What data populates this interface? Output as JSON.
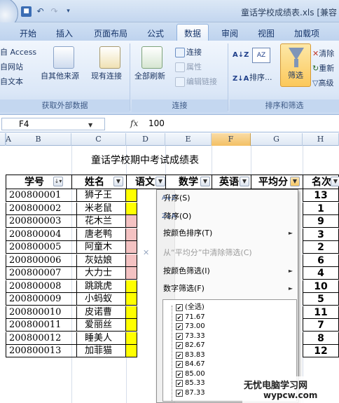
{
  "window": {
    "title": "童话学校成绩表.xls [兼容"
  },
  "tabs": [
    {
      "label": "开始"
    },
    {
      "label": "插入"
    },
    {
      "label": "页面布局"
    },
    {
      "label": "公式"
    },
    {
      "label": "数据"
    },
    {
      "label": "审阅"
    },
    {
      "label": "视图"
    },
    {
      "label": "加载项"
    }
  ],
  "active_tab": "数据",
  "ribbon": {
    "external": {
      "access": "自 Access",
      "web": "自网站",
      "text": "自文本",
      "other_sources": "自其他来源",
      "existing": "现有连接",
      "group_label": "获取外部数据"
    },
    "connections": {
      "refresh_all": "全部刷新",
      "connections": "连接",
      "properties": "属性",
      "edit_links": "编辑链接",
      "group_label": "连接"
    },
    "sort_filter": {
      "sort": "排序...",
      "filter": "筛选",
      "clear": "清除",
      "reapply": "重新",
      "advanced": "高级",
      "group_label": "排序和筛选"
    }
  },
  "formula_bar": {
    "name_box": "F4",
    "fx": "fx",
    "value": "100"
  },
  "columns": [
    "A",
    "B",
    "C",
    "D",
    "E",
    "F",
    "G",
    "H"
  ],
  "selected_column": "F",
  "sheet": {
    "title": "童话学校期中考试成绩表",
    "headers": [
      "学号",
      "姓名",
      "语文",
      "数学",
      "英语",
      "平均分",
      "名次"
    ],
    "rows": [
      {
        "id": "200800001",
        "name": "狮子王",
        "rank": "13",
        "chn_color": "#ffff00"
      },
      {
        "id": "200800002",
        "name": "米老鼠",
        "rank": "1",
        "chn_color": "#ffff00"
      },
      {
        "id": "200800003",
        "name": "花木兰",
        "rank": "9",
        "chn_color": "#f4c2c2"
      },
      {
        "id": "200800004",
        "name": "唐老鸭",
        "rank": "3",
        "chn_color": "#f4c2c2"
      },
      {
        "id": "200800005",
        "name": "阿童木",
        "rank": "2",
        "chn_color": "#f4c2c2"
      },
      {
        "id": "200800006",
        "name": "灰姑娘",
        "rank": "6",
        "chn_color": "#f4c2c2"
      },
      {
        "id": "200800007",
        "name": "大力士",
        "rank": "4",
        "chn_color": "#f4c2c2"
      },
      {
        "id": "200800008",
        "name": "跳跳虎",
        "rank": "10",
        "chn_color": "#ffff00"
      },
      {
        "id": "200800009",
        "name": "小蚂蚁",
        "rank": "5",
        "chn_color": "#ffff00"
      },
      {
        "id": "200800010",
        "name": "皮诺曹",
        "rank": "11",
        "chn_color": "#ffff00"
      },
      {
        "id": "200800011",
        "name": "爱丽丝",
        "rank": "7",
        "chn_color": "#ffff00"
      },
      {
        "id": "200800012",
        "name": "睡美人",
        "rank": "8",
        "chn_color": "#ffff00"
      },
      {
        "id": "200800013",
        "name": "加菲猫",
        "rank": "12",
        "chn_color": "#ffff00"
      }
    ]
  },
  "filter_menu": {
    "sort_asc": "升序(S)",
    "sort_desc": "降序(O)",
    "sort_by_color": "按颜色排序(T)",
    "clear_filter": "从“平均分”中清除筛选(C)",
    "filter_by_color": "按颜色筛选(I)",
    "number_filters": "数字筛选(F)",
    "values": [
      "(全选)",
      "71.67",
      "73.00",
      "73.33",
      "82.67",
      "83.83",
      "84.67",
      "85.00",
      "85.33",
      "87.33"
    ]
  },
  "watermark": {
    "line1": "无忧电脑学习网",
    "line2": "wypcw.com"
  }
}
